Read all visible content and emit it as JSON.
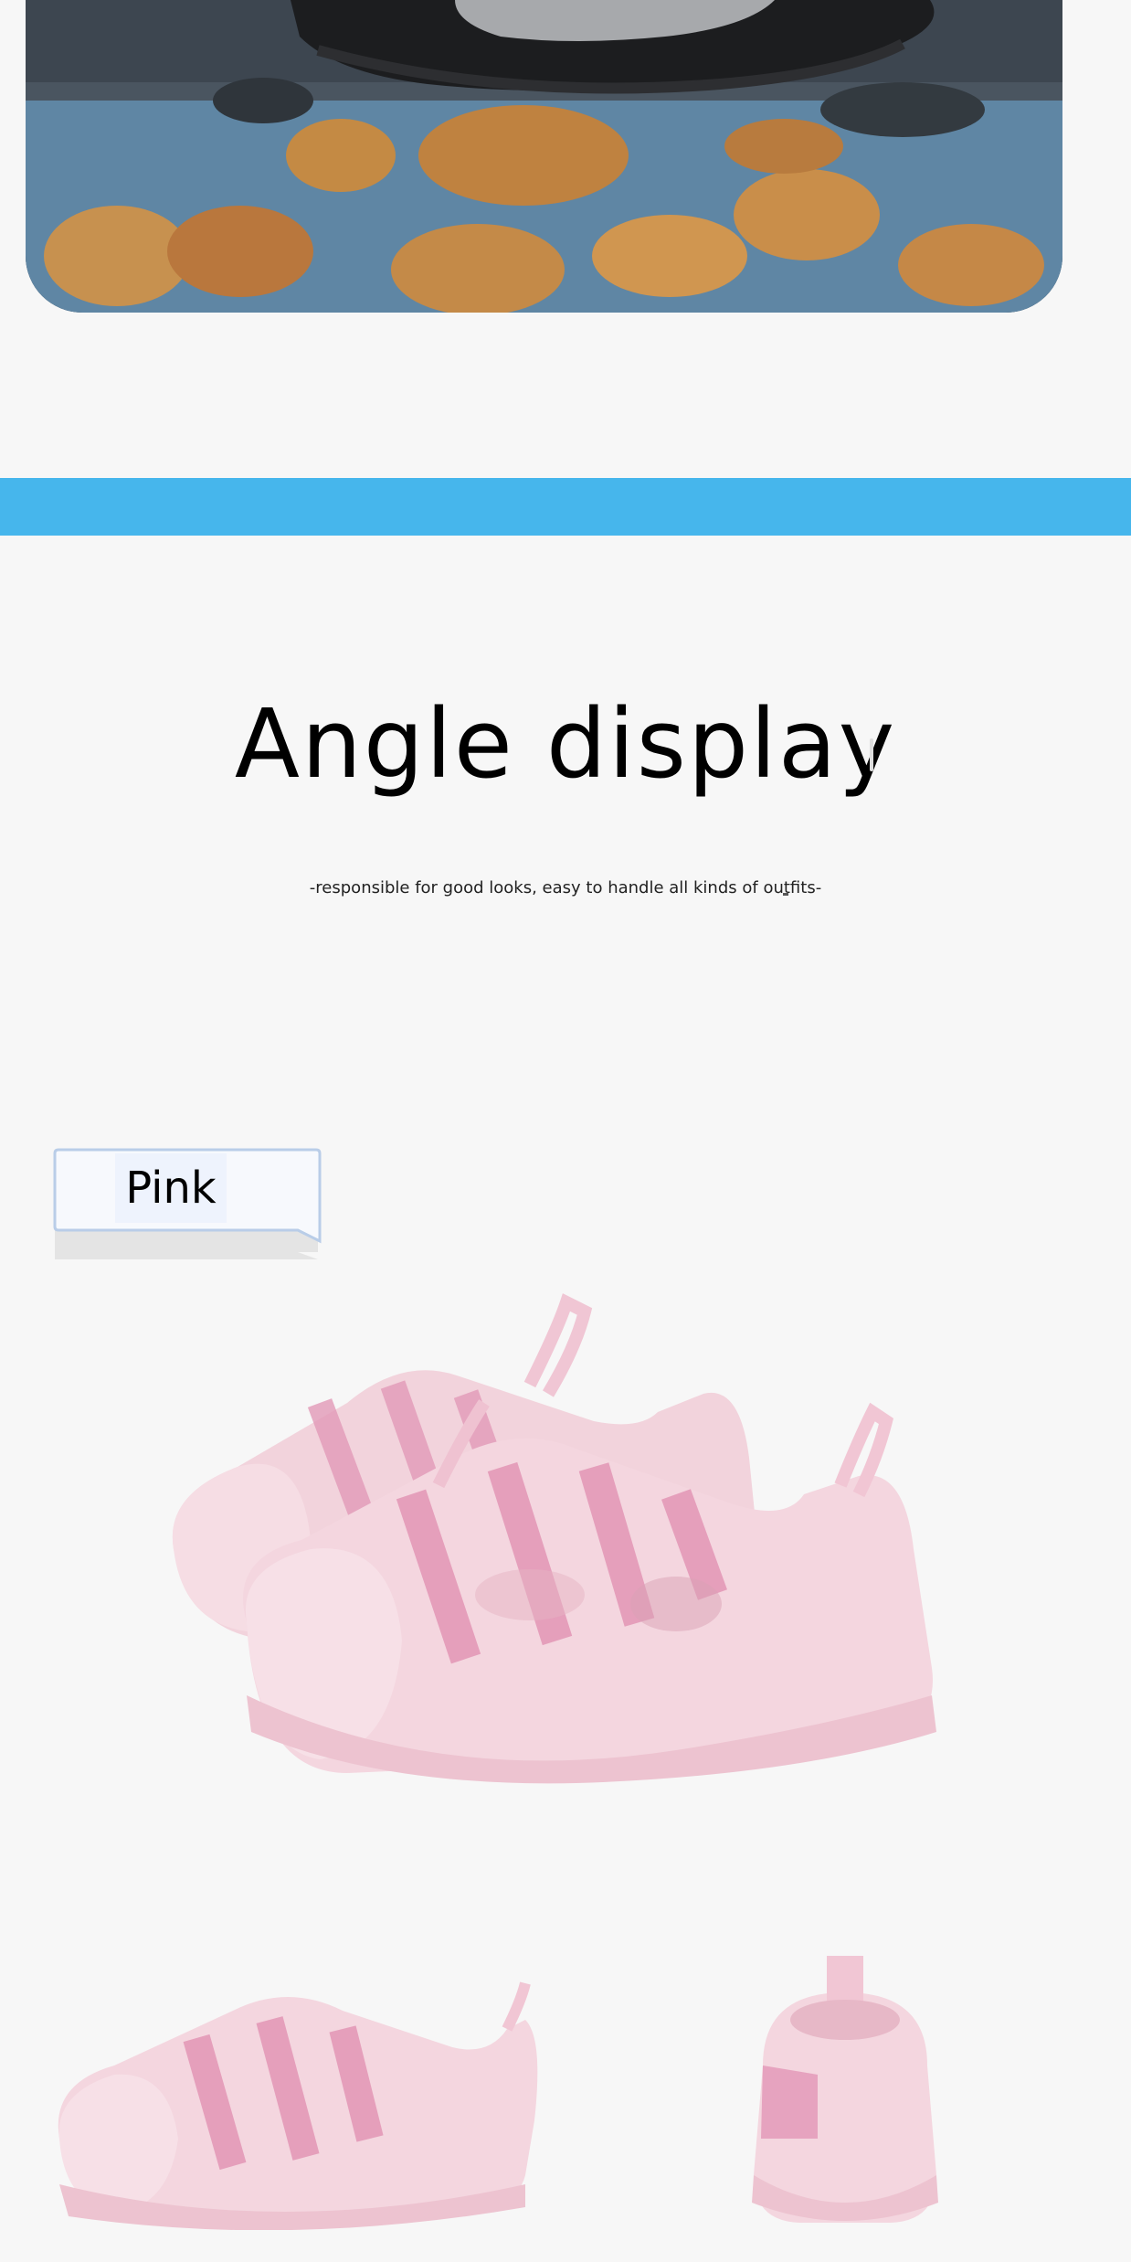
{
  "hero": {
    "description_icon": "product-photo-black-sandal-on-rocks"
  },
  "accent": {
    "band_color": "#46b6ec"
  },
  "section": {
    "title": "Angle display",
    "subtitle": "-responsible for good looks, easy to handle all kinds of outfits-"
  },
  "color_tag": {
    "label": "Pink"
  },
  "images": {
    "main": "pink-sandal-pair-icon",
    "side": "pink-sandal-side-icon",
    "back": "pink-sandal-back-icon"
  }
}
